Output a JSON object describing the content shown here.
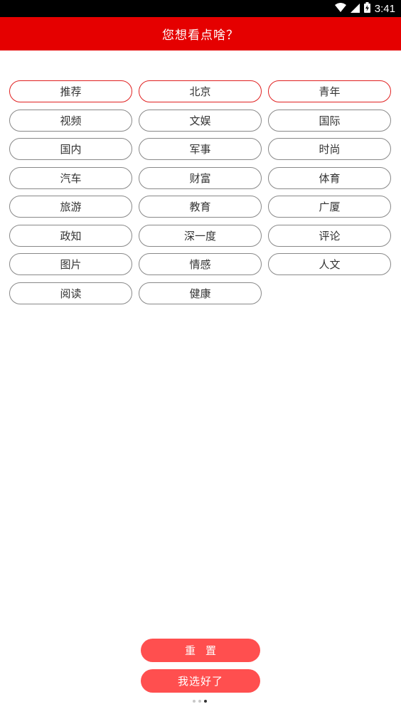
{
  "status_bar": {
    "time": "3:41",
    "icons": [
      "wifi-icon",
      "cellular-signal-icon",
      "battery-charging-icon"
    ]
  },
  "app_bar": {
    "title": "您想看点啥？"
  },
  "categories": [
    {
      "label": "推荐",
      "selected": true
    },
    {
      "label": "北京",
      "selected": true
    },
    {
      "label": "青年",
      "selected": true
    },
    {
      "label": "视频",
      "selected": false
    },
    {
      "label": "文娱",
      "selected": false
    },
    {
      "label": "国际",
      "selected": false
    },
    {
      "label": "国内",
      "selected": false
    },
    {
      "label": "军事",
      "selected": false
    },
    {
      "label": "时尚",
      "selected": false
    },
    {
      "label": "汽车",
      "selected": false
    },
    {
      "label": "财富",
      "selected": false
    },
    {
      "label": "体育",
      "selected": false
    },
    {
      "label": "旅游",
      "selected": false
    },
    {
      "label": "教育",
      "selected": false
    },
    {
      "label": "广厦",
      "selected": false
    },
    {
      "label": "政知",
      "selected": false
    },
    {
      "label": "深一度",
      "selected": false
    },
    {
      "label": "评论",
      "selected": false
    },
    {
      "label": "图片",
      "selected": false
    },
    {
      "label": "情感",
      "selected": false
    },
    {
      "label": "人文",
      "selected": false
    },
    {
      "label": "阅读",
      "selected": false
    },
    {
      "label": "健康",
      "selected": false
    }
  ],
  "actions": {
    "reset_label": "重置",
    "done_label": "我选好了"
  },
  "pager": {
    "total": 3,
    "current": 3
  },
  "colors": {
    "accent": "#e50000",
    "button": "#ff4f4f",
    "selected_border": "#e02020"
  }
}
